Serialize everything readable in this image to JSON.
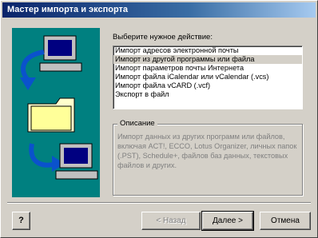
{
  "window": {
    "title": "Мастер импорта и экспорта"
  },
  "main": {
    "prompt": "Выберите нужное действие:",
    "actions": [
      "Импорт адресов электронной почты",
      "Импорт из другой программы или файла",
      "Импорт параметров почты Интернета",
      "Импорт файла iCalendar или vCalendar (.vcs)",
      "Импорт файла vCARD (.vcf)",
      "Экспорт в файл"
    ],
    "selected_index": 1,
    "description_title": "Описание",
    "description": "Импорт данных из других программ или файлов, включая ACT!, ECCO, Lotus Organizer, личных папок (.PST), Schedule+, файлов баз данных, текстовых файлов и других."
  },
  "footer": {
    "help_label": "?",
    "back_label": "< Назад",
    "next_label": "Далее >",
    "cancel_label": "Отмена"
  },
  "colors": {
    "title_bar": "#0a246a",
    "illustration_bg": "#008080",
    "window_bg": "#d4d0c8"
  }
}
